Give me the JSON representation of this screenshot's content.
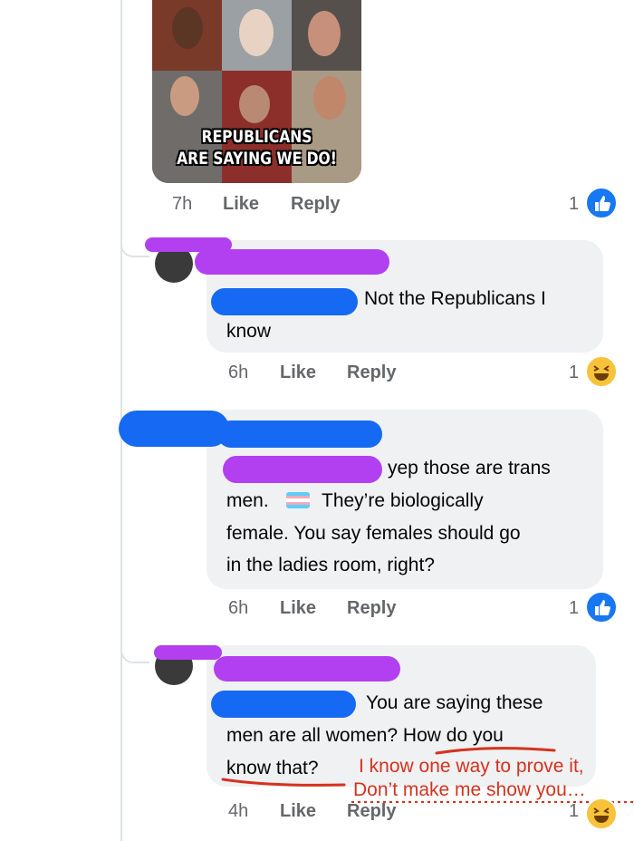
{
  "meme": {
    "caption_line1": "REPUBLICANS",
    "caption_line2": "ARE SAYING WE DO!"
  },
  "comments": [
    {
      "time": "7h",
      "like": "Like",
      "reply": "Reply",
      "reaction_count": "1",
      "reaction": "like-icon"
    },
    {
      "text_line1": "Not the Republicans I",
      "text_line2": "know",
      "time": "6h",
      "like": "Like",
      "reply": "Reply",
      "reaction_count": "1",
      "reaction": "haha-icon"
    },
    {
      "text_line1": "yep those are trans",
      "text_line2a": "men.",
      "text_line2b": "They’re biologically",
      "text_line3": "female. You say females should go",
      "text_line4": "in the ladies room, right?",
      "time": "6h",
      "like": "Like",
      "reply": "Reply",
      "reaction_count": "1",
      "reaction": "like-icon"
    },
    {
      "text_line1": "You are saying these",
      "text_line2": "men are all women?  How do you",
      "text_line3": "know that?",
      "time": "4h",
      "like": "Like",
      "reply": "Reply",
      "reaction_count": "1",
      "reaction": "haha-icon"
    }
  ],
  "annotation": {
    "line1": "I know one way to prove it,",
    "line2": "Don’t make me show you…",
    "color": "#d4321e"
  },
  "colors": {
    "bubble": "#eff1f3",
    "meta_text": "#65676b",
    "like_blue": "#1877f2",
    "scribble_purple": "#b23ff0",
    "scribble_blue": "#1669f2"
  }
}
